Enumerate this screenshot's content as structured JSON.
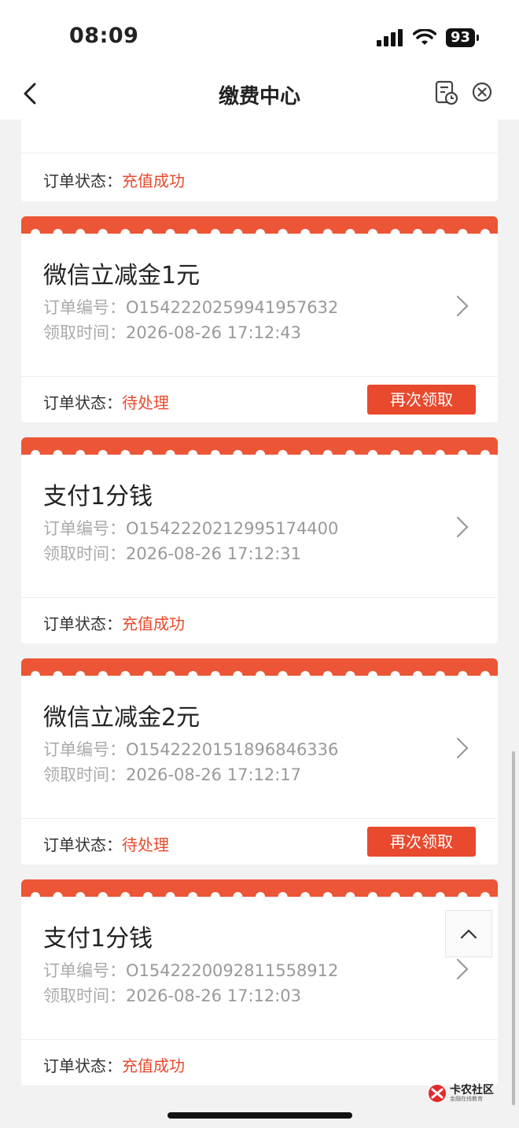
{
  "status_bar": {
    "time": "08:09",
    "battery": "93"
  },
  "nav": {
    "title": "缴费中心"
  },
  "labels": {
    "order_no": "订单编号：",
    "receive_time": "领取时间：",
    "order_status": "订单状态："
  },
  "top_partial_card": {
    "status": "充值成功"
  },
  "cards": [
    {
      "title": "微信立减金1元",
      "order_no": "O1542220259941957632",
      "time": "2026-08-26 17:12:43",
      "status": "待处理",
      "button": "再次领取"
    },
    {
      "title": "支付1分钱",
      "order_no": "O1542220212995174400",
      "time": "2026-08-26 17:12:31",
      "status": "充值成功"
    },
    {
      "title": "微信立减金2元",
      "order_no": "O1542220151896846336",
      "time": "2026-08-26 17:12:17",
      "status": "待处理",
      "button": "再次领取"
    },
    {
      "title": "支付1分钱",
      "order_no": "O1542220092811558912",
      "time": "2026-08-26 17:12:03",
      "status": "充值成功"
    }
  ],
  "watermark": {
    "name": "卡农社区",
    "slogan": "金融在线教育"
  },
  "colors": {
    "accent": "#e9492d",
    "ribbon": "#ec5535"
  }
}
